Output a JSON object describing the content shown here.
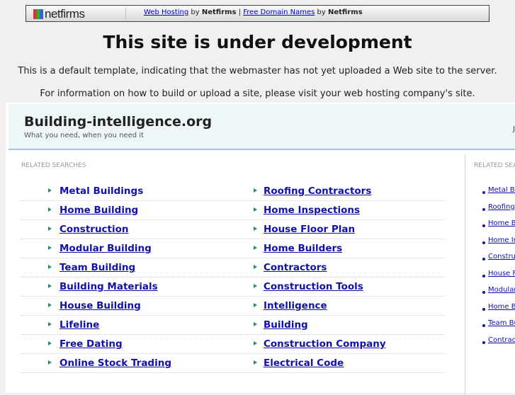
{
  "topbar": {
    "logo": "netfirms",
    "link1": "Web Hosting",
    "by1": "by",
    "brand1": "Netfirms",
    "pipe": "|",
    "link2": "Free Domain Names",
    "by2": "by",
    "brand2": "Netfirms"
  },
  "title": "This site is under development",
  "info1": "This is a default template, indicating that the webmaster has not yet uploaded a Web site to the server.",
  "info2": "For information on how to build or upload a site, please visit your web hosting company's site.",
  "site": {
    "name": "Building-intelligence.org",
    "tagline": "What you need, when you need it",
    "right_fragment": "Ju"
  },
  "related_label": "RELATED SEARCHES",
  "related_label_right": "RELATED SEARCHES",
  "left_col": [
    "Metal Buildings",
    "Home Building",
    "Construction",
    "Modular Building",
    "Team Building",
    "Building Materials",
    "House Building",
    "Lifeline",
    "Free Dating",
    "Online Stock Trading"
  ],
  "mid_col": [
    "Roofing Contractors",
    "Home Inspections",
    "House Floor Plan",
    "Home Builders",
    "Contractors",
    "Construction Tools",
    "Intelligence",
    "Building",
    "Construction Company",
    "Electrical Code"
  ],
  "right_col": [
    "Metal Buildings",
    "Roofing Contractors",
    "Home Building",
    "Home Inspections",
    "Construction",
    "House Floor Plan",
    "Modular Building",
    "Home Builders",
    "Team Building",
    "Contractors"
  ]
}
